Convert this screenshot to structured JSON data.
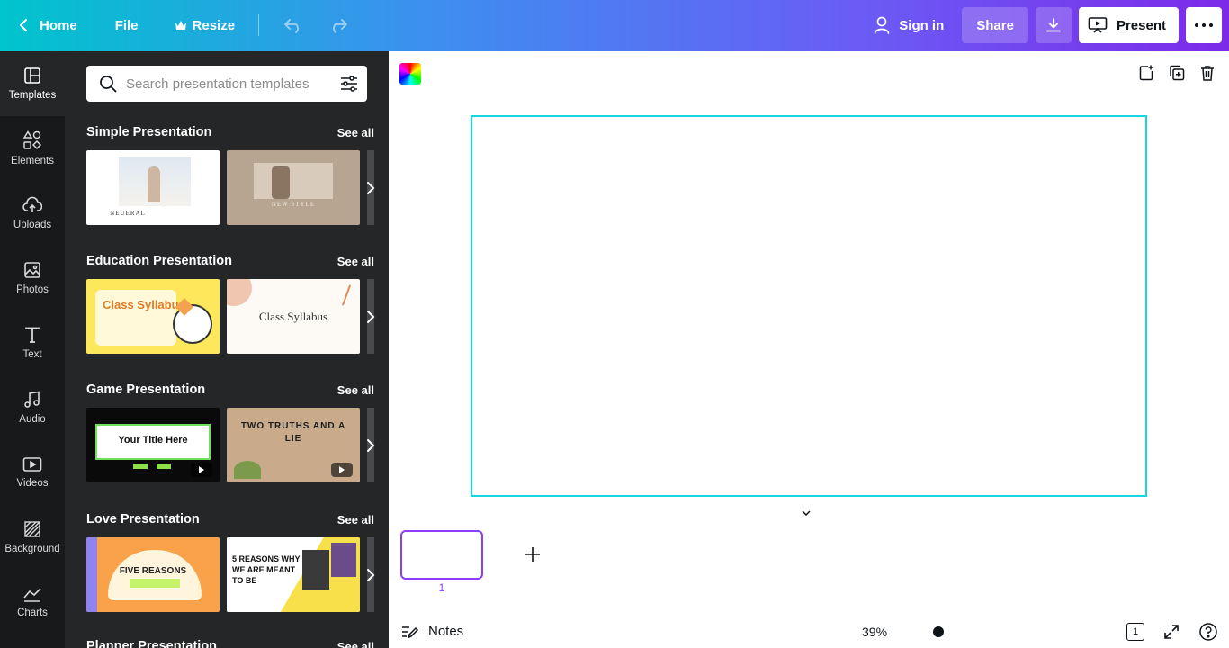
{
  "topbar": {
    "home_label": "Home",
    "file_label": "File",
    "resize_label": "Resize",
    "signin_label": "Sign in",
    "share_label": "Share",
    "present_label": "Present"
  },
  "rail": {
    "items": [
      {
        "label": "Templates",
        "icon": "templates-icon"
      },
      {
        "label": "Elements",
        "icon": "elements-icon"
      },
      {
        "label": "Uploads",
        "icon": "uploads-icon"
      },
      {
        "label": "Photos",
        "icon": "photos-icon"
      },
      {
        "label": "Text",
        "icon": "text-icon"
      },
      {
        "label": "Audio",
        "icon": "audio-icon"
      },
      {
        "label": "Videos",
        "icon": "videos-icon"
      },
      {
        "label": "Background",
        "icon": "background-icon"
      },
      {
        "label": "Charts",
        "icon": "charts-icon"
      }
    ]
  },
  "panel": {
    "search_placeholder": "Search presentation templates",
    "see_all": "See all",
    "sections": [
      {
        "title": "Simple Presentation",
        "t1": "NEUERAL",
        "t2": "NEW STYLE"
      },
      {
        "title": "Education Presentation",
        "t1": "Class Syllabus",
        "t2": "Class Syllabus"
      },
      {
        "title": "Game Presentation",
        "t1": "Your Title Here",
        "t2": "TWO TRUTHS AND A LIE"
      },
      {
        "title": "Love Presentation",
        "t1": "FIVE REASONS",
        "t2": "5 REASONS WHY WE ARE MEANT TO BE"
      },
      {
        "title": "Planner Presentation"
      }
    ]
  },
  "canvas": {
    "page_number": "1",
    "notes_label": "Notes",
    "zoom": "39%",
    "page_count": "1"
  },
  "colors": {
    "accent": "#8b3dff",
    "slide_border": "#13d6e0",
    "rail_bg": "#18191b",
    "panel_bg": "#252627"
  }
}
